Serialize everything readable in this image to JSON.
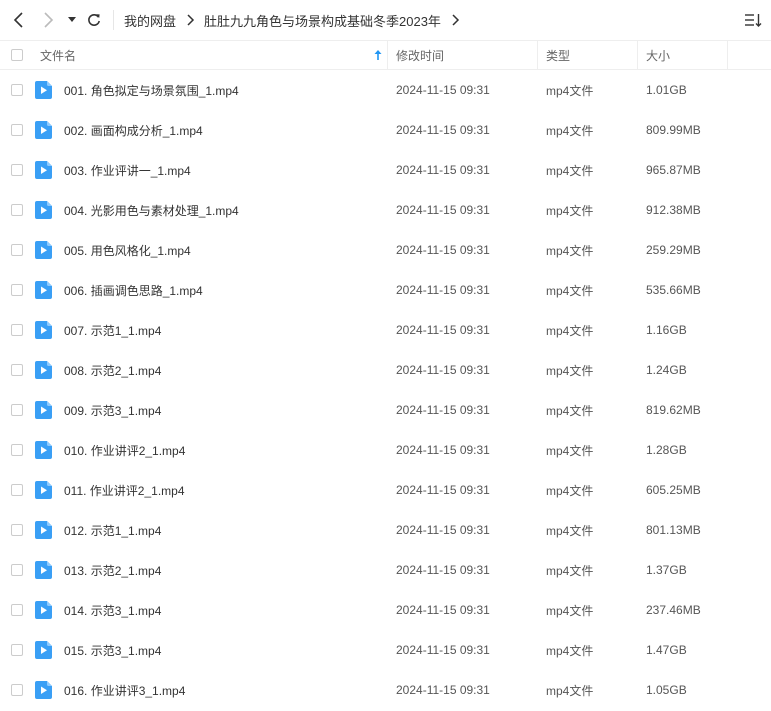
{
  "breadcrumb": {
    "root": "我的网盘",
    "current": "肚肚九九角色与场景构成基础冬季2023年"
  },
  "columns": {
    "name": "文件名",
    "modified": "修改时间",
    "type": "类型",
    "size": "大小"
  },
  "files": [
    {
      "name": "001. 角色拟定与场景氛围_1.mp4",
      "modified": "2024-11-15 09:31",
      "type": "mp4文件",
      "size": "1.01GB"
    },
    {
      "name": "002. 画面构成分析_1.mp4",
      "modified": "2024-11-15 09:31",
      "type": "mp4文件",
      "size": "809.99MB"
    },
    {
      "name": "003. 作业评讲一_1.mp4",
      "modified": "2024-11-15 09:31",
      "type": "mp4文件",
      "size": "965.87MB"
    },
    {
      "name": "004. 光影用色与素材处理_1.mp4",
      "modified": "2024-11-15 09:31",
      "type": "mp4文件",
      "size": "912.38MB"
    },
    {
      "name": "005. 用色风格化_1.mp4",
      "modified": "2024-11-15 09:31",
      "type": "mp4文件",
      "size": "259.29MB"
    },
    {
      "name": "006. 插画调色思路_1.mp4",
      "modified": "2024-11-15 09:31",
      "type": "mp4文件",
      "size": "535.66MB"
    },
    {
      "name": "007. 示范1_1.mp4",
      "modified": "2024-11-15 09:31",
      "type": "mp4文件",
      "size": "1.16GB"
    },
    {
      "name": "008. 示范2_1.mp4",
      "modified": "2024-11-15 09:31",
      "type": "mp4文件",
      "size": "1.24GB"
    },
    {
      "name": "009. 示范3_1.mp4",
      "modified": "2024-11-15 09:31",
      "type": "mp4文件",
      "size": "819.62MB"
    },
    {
      "name": "010. 作业讲评2_1.mp4",
      "modified": "2024-11-15 09:31",
      "type": "mp4文件",
      "size": "1.28GB"
    },
    {
      "name": "011. 作业讲评2_1.mp4",
      "modified": "2024-11-15 09:31",
      "type": "mp4文件",
      "size": "605.25MB"
    },
    {
      "name": "012. 示范1_1.mp4",
      "modified": "2024-11-15 09:31",
      "type": "mp4文件",
      "size": "801.13MB"
    },
    {
      "name": "013. 示范2_1.mp4",
      "modified": "2024-11-15 09:31",
      "type": "mp4文件",
      "size": "1.37GB"
    },
    {
      "name": "014. 示范3_1.mp4",
      "modified": "2024-11-15 09:31",
      "type": "mp4文件",
      "size": "237.46MB"
    },
    {
      "name": "015. 示范3_1.mp4",
      "modified": "2024-11-15 09:31",
      "type": "mp4文件",
      "size": "1.47GB"
    },
    {
      "name": "016. 作业讲评3_1.mp4",
      "modified": "2024-11-15 09:31",
      "type": "mp4文件",
      "size": "1.05GB"
    }
  ],
  "icons": {
    "back": "chevron-left-icon",
    "forward": "chevron-right-icon",
    "history": "caret-down-icon",
    "refresh": "refresh-icon",
    "view": "sort-list-icon",
    "file": "video-file-icon",
    "sort": "sort-ascending-icon"
  },
  "colors": {
    "accent": "#3a9ff5",
    "sort_arrow": "#2196f3",
    "icon_dark": "#333333",
    "icon_disabled": "#bbbbbb"
  }
}
